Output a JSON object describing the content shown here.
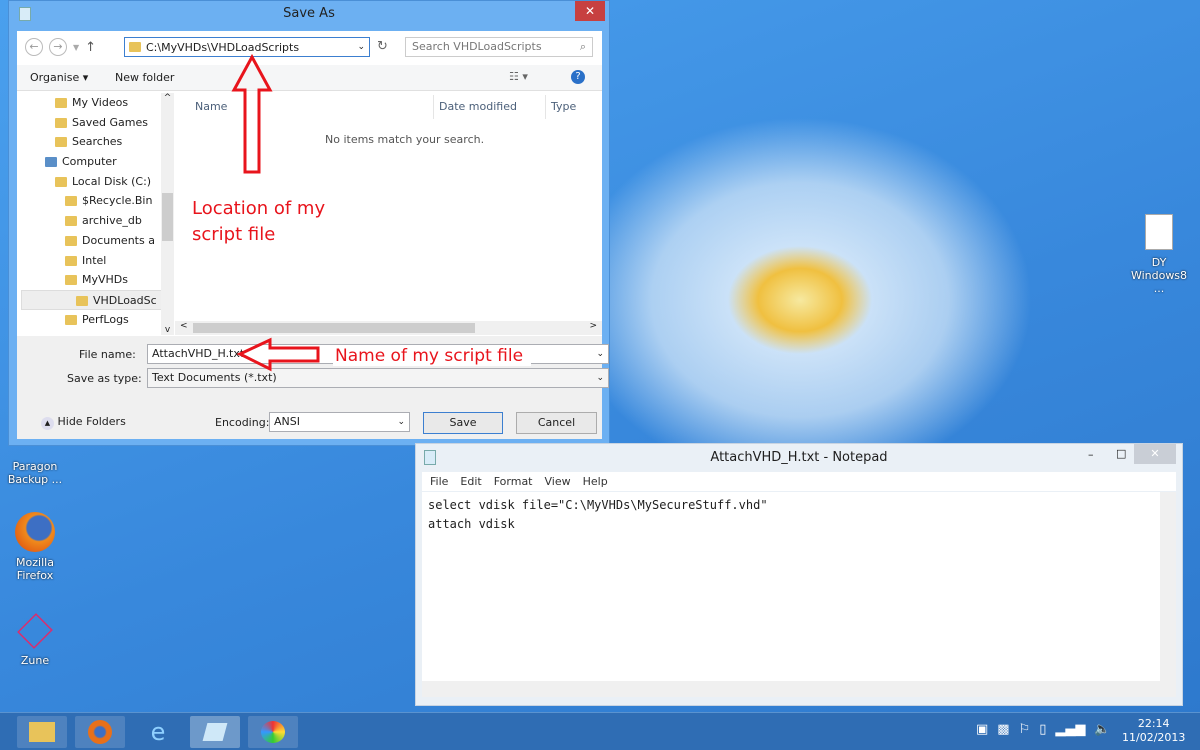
{
  "save_dialog": {
    "title": "Save As",
    "close": "✕",
    "address": "C:\\MyVHDs\\VHDLoadScripts",
    "search_placeholder": "Search VHDLoadScripts",
    "organise": "Organise ▾",
    "new_folder": "New folder",
    "help": "?",
    "tree": [
      {
        "label": "My Videos",
        "indent": 1
      },
      {
        "label": "Saved Games",
        "indent": 1
      },
      {
        "label": "Searches",
        "indent": 1
      },
      {
        "label": "Computer",
        "indent": 0
      },
      {
        "label": "Local Disk (C:)",
        "indent": 1
      },
      {
        "label": "$Recycle.Bin",
        "indent": 2
      },
      {
        "label": "archive_db",
        "indent": 2
      },
      {
        "label": "Documents a",
        "indent": 2
      },
      {
        "label": "Intel",
        "indent": 2
      },
      {
        "label": "MyVHDs",
        "indent": 2
      },
      {
        "label": "VHDLoadSc",
        "indent": 3,
        "selected": true
      },
      {
        "label": "PerfLogs",
        "indent": 2
      }
    ],
    "columns": [
      "Name",
      "Date modified",
      "Type"
    ],
    "empty_message": "No items match your search.",
    "file_name_label": "File name:",
    "file_name": "AttachVHD_H.txt",
    "save_type_label": "Save as type:",
    "save_type": "Text Documents (*.txt)",
    "hide_folders": "Hide Folders",
    "encoding_label": "Encoding:",
    "encoding": "ANSI",
    "save": "Save",
    "cancel": "Cancel"
  },
  "annotations": {
    "location": "Location of my\nscript file",
    "name": "Name of my script file",
    "color": "#e8141c"
  },
  "notepad": {
    "title": "AttachVHD_H.txt - Notepad",
    "menu": [
      "File",
      "Edit",
      "Format",
      "View",
      "Help"
    ],
    "content": "select vdisk file=\"C:\\MyVHDs\\MySecureStuff.vhd\"\nattach vdisk"
  },
  "desktop": {
    "icons": [
      {
        "label": "Paragon Backup ..."
      },
      {
        "label": "Mozilla Firefox"
      },
      {
        "label": "Zune"
      },
      {
        "label": "DY Windows8 ..."
      }
    ]
  },
  "taskbar": {
    "time": "22:14",
    "date": "11/02/2013",
    "apps": [
      "file-explorer",
      "firefox",
      "internet-explorer",
      "notepad",
      "paint"
    ]
  }
}
